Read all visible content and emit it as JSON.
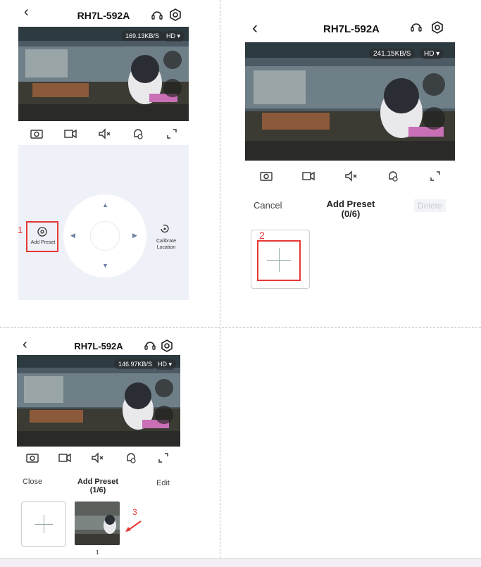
{
  "annotations": {
    "n1": "1",
    "n2": "2",
    "n3": "3"
  },
  "panel1": {
    "title": "RH7L-592A",
    "speed": "169.13KB/S",
    "quality": "HD ▾",
    "add_preset": "Add Preset",
    "calibrate": "Calibrate\nLocation"
  },
  "panel2": {
    "title": "RH7L-592A",
    "speed": "241.15KB/S",
    "quality": "HD ▾",
    "cancel": "Cancel",
    "add_preset_title": "Add Preset",
    "count": "(0/6)",
    "delete": "Delete"
  },
  "panel3": {
    "title": "RH7L-592A",
    "speed": "146.97KB/S",
    "quality": "HD ▾",
    "close": "Close",
    "add_preset_title": "Add Preset",
    "count": "(1/6)",
    "edit": "Edit",
    "preset_index": "1"
  },
  "icons": [
    "back-icon",
    "headset-icon",
    "settings-icon",
    "camera-icon",
    "record-icon",
    "mute-icon",
    "alarm-icon",
    "fullscreen-icon",
    "playback-icon",
    "pip-icon",
    "preset-icon",
    "calibrate-icon",
    "plus-icon",
    "arrow-icon"
  ],
  "colors": {
    "accent_red": "#e53935",
    "ptz_bg": "#eff1f8",
    "delete_bg": "#f2f4f8"
  }
}
